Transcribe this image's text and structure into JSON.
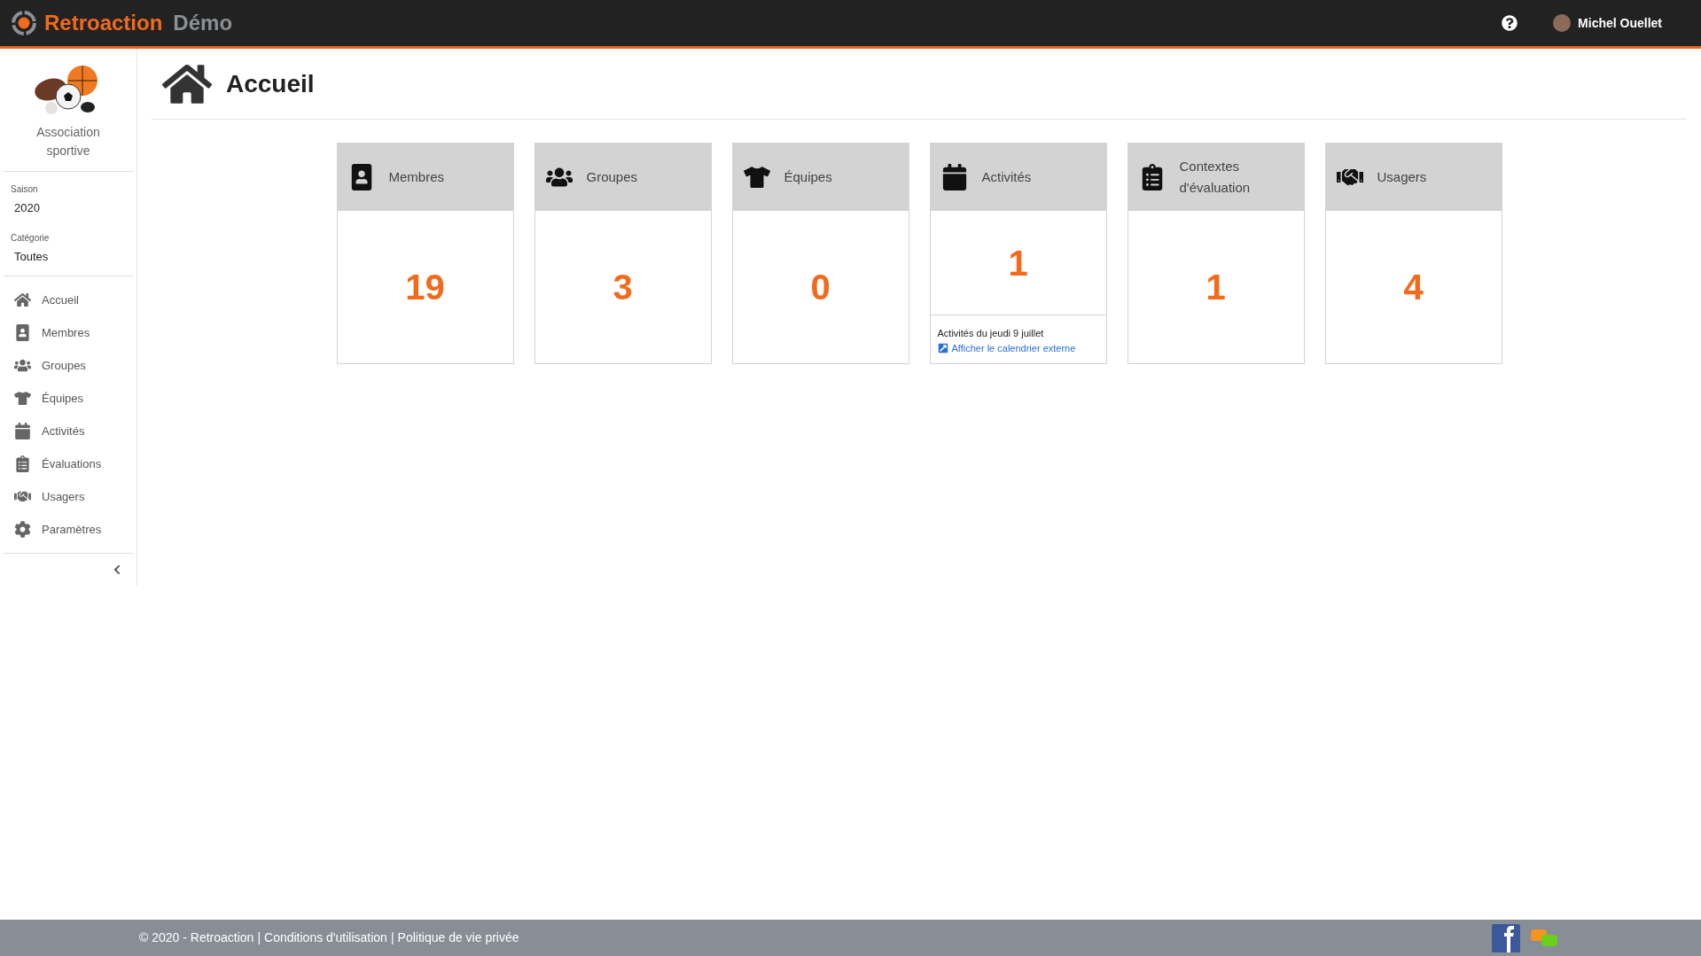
{
  "header": {
    "brand": "Retroaction",
    "edition": "Démo",
    "user": "Michel Ouellet"
  },
  "sidebar": {
    "organization": "Association sportive",
    "season": {
      "label": "Saison",
      "value": "2020"
    },
    "category": {
      "label": "Catégorie",
      "value": "Toutes"
    },
    "items": [
      {
        "label": "Accueil"
      },
      {
        "label": "Membres"
      },
      {
        "label": "Groupes"
      },
      {
        "label": "Équipes"
      },
      {
        "label": "Activités"
      },
      {
        "label": "Évaluations"
      },
      {
        "label": "Usagers"
      },
      {
        "label": "Paramètres"
      }
    ]
  },
  "page": {
    "title": "Accueil"
  },
  "cards": [
    {
      "title": "Membres",
      "count": "19"
    },
    {
      "title": "Groupes",
      "count": "3"
    },
    {
      "title": "Équipes",
      "count": "0"
    },
    {
      "title": "Activités",
      "count": "1",
      "note": "Activités du jeudi 9 juillet",
      "link": "Afficher le calendrier externe"
    },
    {
      "title": "Contextes d'évaluation",
      "count": "1"
    },
    {
      "title": "Usagers",
      "count": "4"
    }
  ],
  "footer": {
    "copyright": "© 2020 - Retroaction",
    "links": [
      "Conditions d'utilisation",
      "Politique de vie privée"
    ],
    "separator": "|"
  }
}
